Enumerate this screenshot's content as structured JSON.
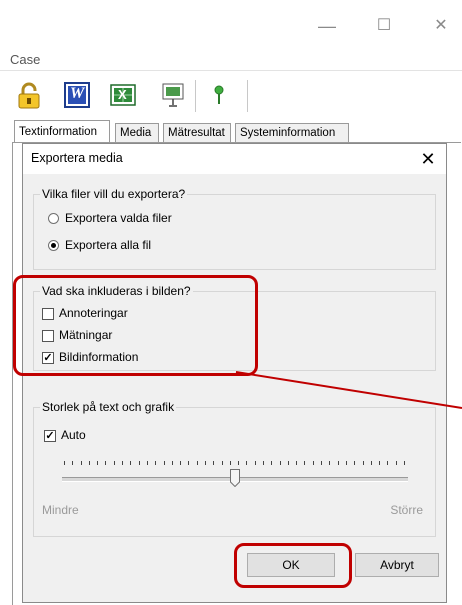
{
  "window": {
    "title": "Case",
    "minimize_glyph": "—",
    "maximize_glyph": "☐",
    "close_glyph": "✕"
  },
  "toolbar": {
    "icons": [
      "lock-icon",
      "word-icon",
      "excel-icon",
      "presentation-icon",
      "pin-icon"
    ],
    "word_letter": "W",
    "excel_letter": "X"
  },
  "tabs": [
    "Textinformation",
    "Media",
    "Mätresultat",
    "Systeminformation"
  ],
  "dialog": {
    "title": "Exportera media",
    "close_glyph": "✕",
    "files_group": {
      "legend": "Vilka filer vill du exportera?",
      "options": [
        {
          "label": "Exportera valda filer",
          "selected": false
        },
        {
          "label": "Exportera alla fil",
          "selected": true
        }
      ]
    },
    "include_group": {
      "legend": "Vad ska inkluderas i bilden?",
      "options": [
        {
          "label": "Annoteringar",
          "checked": false
        },
        {
          "label": "Mätningar",
          "checked": false
        },
        {
          "label": "Bildinformation",
          "checked": true
        }
      ]
    },
    "size_group": {
      "legend": "Storlek på text och grafik",
      "auto_label": "Auto",
      "auto_checked": true,
      "slider_min_label": "Mindre",
      "slider_max_label": "Större",
      "slider_level": 0.5
    },
    "ok_label": "OK",
    "cancel_label": "Avbryt",
    "check_glyph": "✓"
  },
  "colors": {
    "highlight": "#c00000"
  }
}
